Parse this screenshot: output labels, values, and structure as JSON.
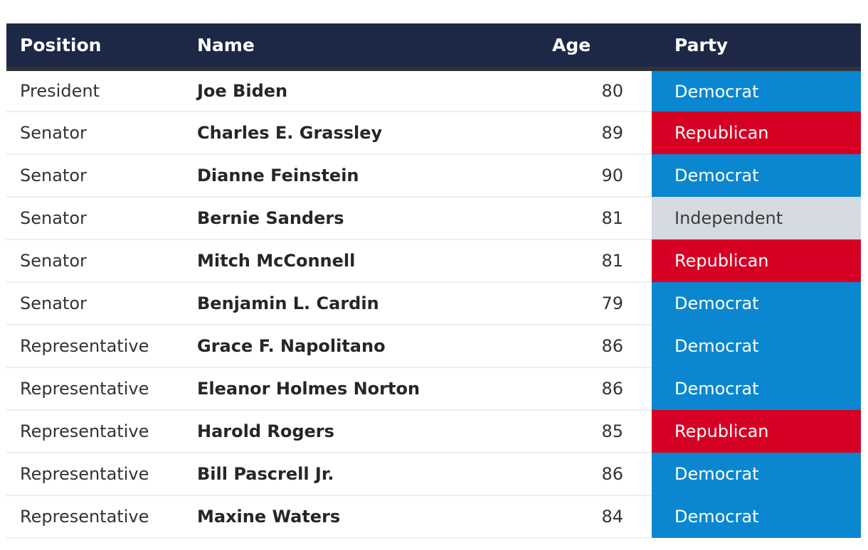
{
  "table": {
    "columns": [
      {
        "key": "position",
        "label": "Position",
        "align": "left"
      },
      {
        "key": "name",
        "label": "Name",
        "align": "left"
      },
      {
        "key": "age",
        "label": "Age",
        "align": "right"
      },
      {
        "key": "party",
        "label": "Party",
        "align": "left"
      }
    ],
    "rows": [
      {
        "position": "President",
        "name": "Joe Biden",
        "age": "80",
        "party": "Democrat"
      },
      {
        "position": "Senator",
        "name": "Charles E. Grassley",
        "age": "89",
        "party": "Republican"
      },
      {
        "position": "Senator",
        "name": "Dianne Feinstein",
        "age": "90",
        "party": "Democrat"
      },
      {
        "position": "Senator",
        "name": "Bernie Sanders",
        "age": "81",
        "party": "Independent"
      },
      {
        "position": "Senator",
        "name": "Mitch McConnell",
        "age": "81",
        "party": "Republican"
      },
      {
        "position": "Senator",
        "name": "Benjamin L. Cardin",
        "age": "79",
        "party": "Democrat"
      },
      {
        "position": "Representative",
        "name": "Grace F. Napolitano",
        "age": "86",
        "party": "Democrat"
      },
      {
        "position": "Representative",
        "name": "Eleanor Holmes Norton",
        "age": "86",
        "party": "Democrat"
      },
      {
        "position": "Representative",
        "name": "Harold Rogers",
        "age": "85",
        "party": "Republican"
      },
      {
        "position": "Representative",
        "name": "Bill Pascrell Jr.",
        "age": "86",
        "party": "Democrat"
      },
      {
        "position": "Representative",
        "name": "Maxine Waters",
        "age": "84",
        "party": "Democrat"
      }
    ],
    "colors": {
      "header_background": "#1c2846",
      "header_text": "#ffffff",
      "header_rule": "#2f3338",
      "row_separator": "#eeeeee",
      "body_background": "#ffffff",
      "position_text": "#333333",
      "name_text": "#262626",
      "age_text": "#333333",
      "democrat": "#0a87d0",
      "republican": "#d50023",
      "independent": "#d6dae1",
      "independent_text": "#3c3c3c",
      "party_text": "#ffffff"
    }
  }
}
